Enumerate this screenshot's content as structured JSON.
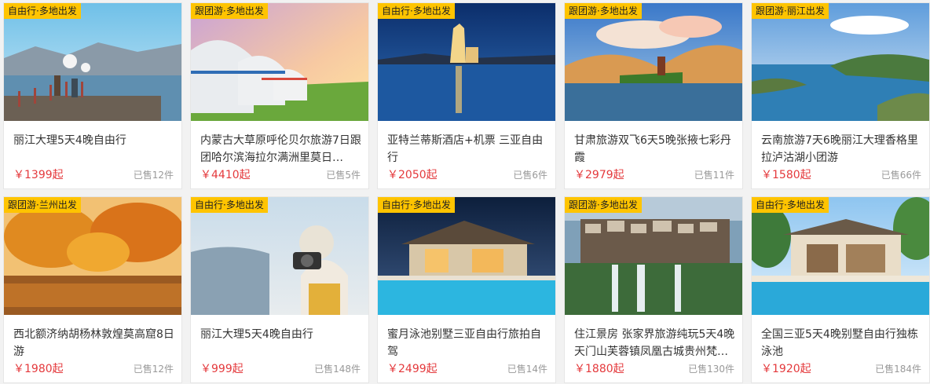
{
  "cards": [
    {
      "tag": "自由行·多地出发",
      "title": "丽江大理5天4晚自由行",
      "price": "￥1399起",
      "sold": "已售12件",
      "image": "lake-pier-people-balloons"
    },
    {
      "tag": "跟团游·多地出发",
      "title": "内蒙古大草原呼伦贝尔旅游7日跟团哈尔滨海拉尔满洲里莫日…",
      "price": "￥4410起",
      "sold": "已售5件",
      "image": "grassland-yurts-sunset"
    },
    {
      "tag": "自由行·多地出发",
      "title": "亚特兰蒂斯酒店+机票 三亚自由行",
      "price": "￥2050起",
      "sold": "已售6件",
      "image": "night-hotel-reflection"
    },
    {
      "tag": "跟团游·多地出发",
      "title": "甘肃旅游双飞6天5晚张掖七彩丹霞",
      "price": "￥2979起",
      "sold": "已售11件",
      "image": "desert-oasis-pagoda"
    },
    {
      "tag": "跟团游·丽江出发",
      "title": "云南旅游7天6晚丽江大理香格里拉泸沽湖小团游",
      "price": "￥1580起",
      "sold": "已售66件",
      "image": "blue-lake-islands"
    },
    {
      "tag": "跟团游·兰州出发",
      "title": "西北额济纳胡杨林敦煌莫高窟8日游",
      "price": "￥1980起",
      "sold": "已售12件",
      "image": "autumn-poplar-forest"
    },
    {
      "tag": "自由行·多地出发",
      "title": "丽江大理5天4晚自由行",
      "price": "￥999起",
      "sold": "已售148件",
      "image": "girl-with-camera"
    },
    {
      "tag": "自由行·多地出发",
      "title": "蜜月泳池别墅三亚自由行旅拍自驾",
      "price": "￥2499起",
      "sold": "已售14件",
      "image": "pool-villa-dusk"
    },
    {
      "tag": "跟团游·多地出发",
      "title": "住江景房 张家界旅游纯玩5天4晚天门山芙蓉镇凤凰古城贵州梵…",
      "price": "￥1880起",
      "sold": "已售130件",
      "image": "waterfall-town"
    },
    {
      "tag": "自由行·多地出发",
      "title": "全国三亚5天4晚别墅自由行独栋泳池",
      "price": "￥1920起",
      "sold": "已售184件",
      "image": "pool-villa-day"
    }
  ]
}
